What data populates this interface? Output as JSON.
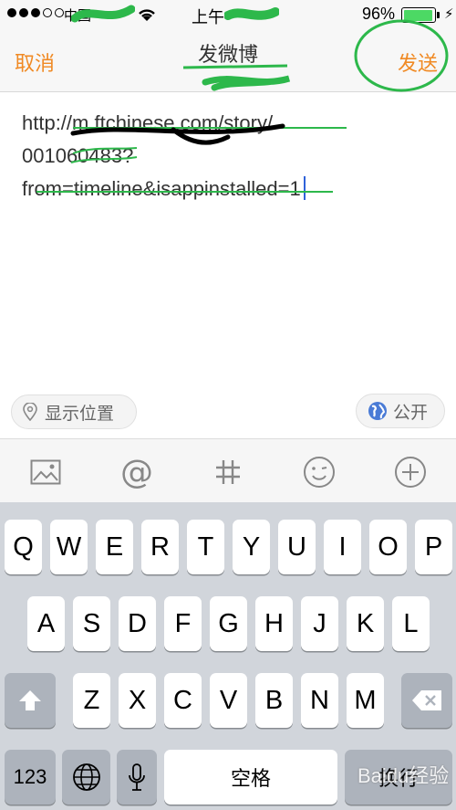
{
  "status_bar": {
    "carrier": "中国",
    "time": "上午",
    "battery_percent": "96%",
    "battery_level": 0.96
  },
  "nav": {
    "cancel": "取消",
    "title": "发微博",
    "send": "发送"
  },
  "compose": {
    "lines": [
      "http://m.ftchinese.com/story/",
      "001060483?",
      "from=timeline&isappinstalled=1"
    ]
  },
  "location": {
    "label": "显示位置",
    "icon": "location-pin-icon"
  },
  "visibility": {
    "label": "公开",
    "icon": "globe-icon"
  },
  "toolbar": {
    "icons": [
      "image-icon",
      "at-icon",
      "hashtag-icon",
      "emoji-icon",
      "plus-icon"
    ],
    "at_symbol": "@"
  },
  "keyboard": {
    "row1": [
      "Q",
      "W",
      "E",
      "R",
      "T",
      "Y",
      "U",
      "I",
      "O",
      "P"
    ],
    "row2": [
      "A",
      "S",
      "D",
      "F",
      "G",
      "H",
      "J",
      "K",
      "L"
    ],
    "row3": [
      "Z",
      "X",
      "C",
      "V",
      "B",
      "N",
      "M"
    ],
    "num": "123",
    "space": "空格",
    "return": "换行"
  },
  "colors": {
    "accent": "#f08a24",
    "annotation": "#2db84b",
    "caret": "#2f62d9"
  },
  "watermark": "Baidu经验"
}
